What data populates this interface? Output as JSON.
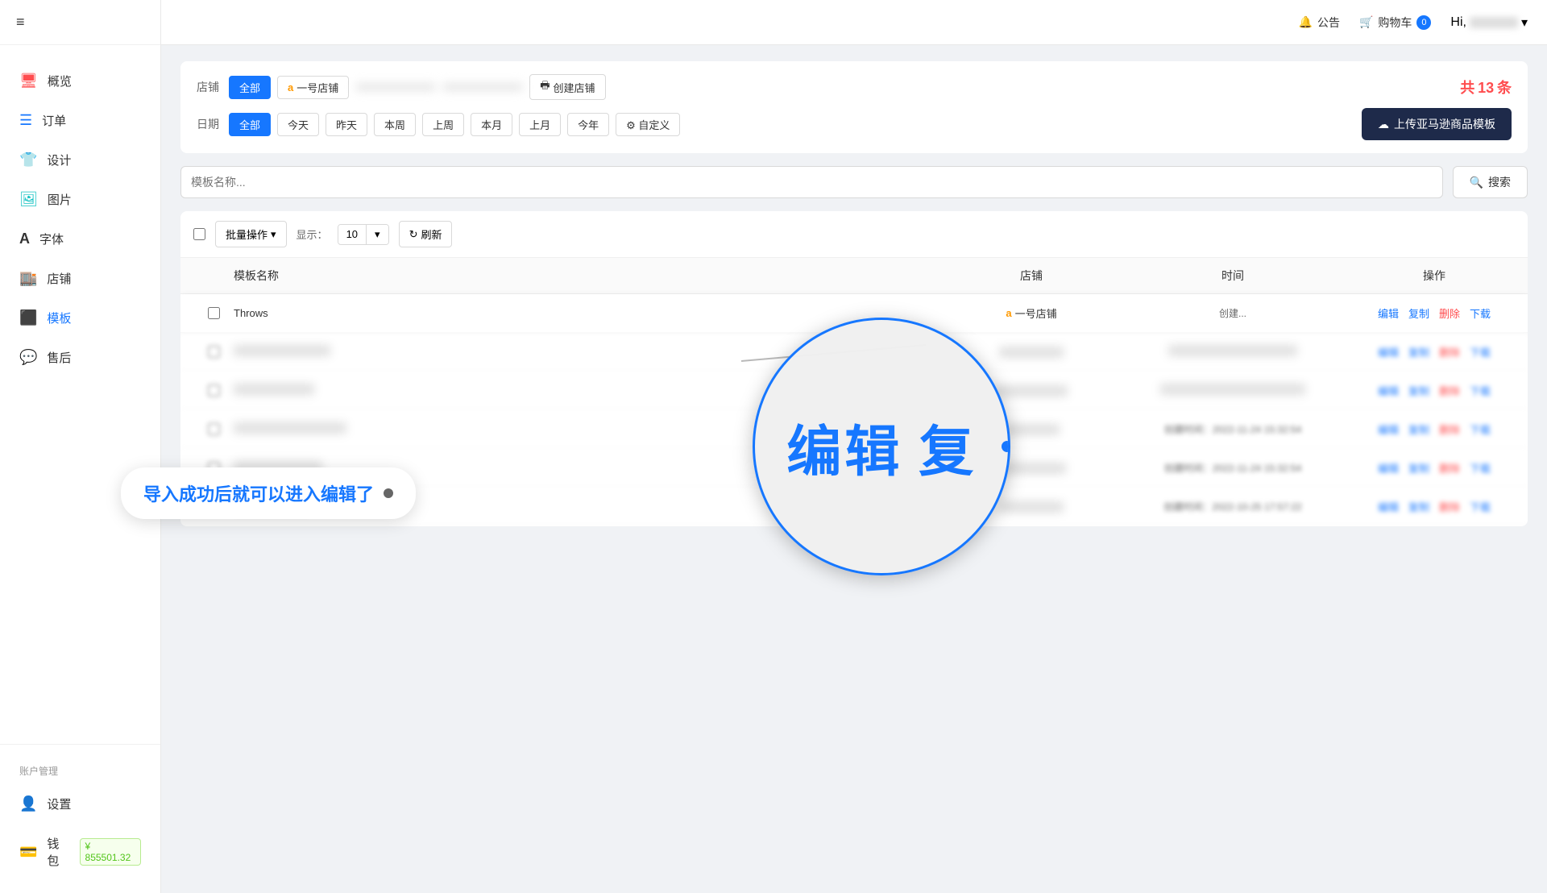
{
  "sidebar": {
    "hamburger": "≡",
    "items": [
      {
        "id": "overview",
        "label": "概览",
        "icon": "📊",
        "class": "overview"
      },
      {
        "id": "orders",
        "label": "订单",
        "icon": "≡",
        "class": "orders"
      },
      {
        "id": "design",
        "label": "设计",
        "icon": "👕",
        "class": "design"
      },
      {
        "id": "images",
        "label": "图片",
        "icon": "🖼",
        "class": "images"
      },
      {
        "id": "fonts",
        "label": "字体",
        "icon": "A",
        "class": "fonts"
      },
      {
        "id": "stores",
        "label": "店铺",
        "icon": "🏬",
        "class": "stores"
      },
      {
        "id": "templates",
        "label": "模板",
        "icon": "⬛",
        "class": "templates"
      },
      {
        "id": "aftersale",
        "label": "售后",
        "icon": "💬",
        "class": "aftersale"
      }
    ],
    "account_label": "账户管理",
    "footer_items": [
      {
        "id": "settings",
        "label": "设置",
        "icon": "👤",
        "class": "settings"
      },
      {
        "id": "wallet",
        "label": "钱包",
        "icon": "💳",
        "class": "wallet",
        "balance": "¥ 855501.32"
      }
    ]
  },
  "topbar": {
    "announcement": "公告",
    "cart": "购物车",
    "cart_count": "0",
    "hi_text": "Hi,"
  },
  "filters": {
    "store_label": "店铺",
    "all_label": "全部",
    "store1": "一号店铺",
    "create_store": "创建店铺",
    "date_label": "日期",
    "date_options": [
      "全部",
      "今天",
      "昨天",
      "本周",
      "上周",
      "本月",
      "上月",
      "今年"
    ],
    "custom_label": "自定义",
    "total_count": "13",
    "total_prefix": "共",
    "total_suffix": "条",
    "upload_btn": "上传亚马逊商品模板"
  },
  "search": {
    "placeholder": "模板名称...",
    "btn_label": "搜索"
  },
  "toolbar": {
    "batch_label": "批量操作",
    "display_label": "显示：",
    "display_count": "10",
    "refresh_label": "刷新"
  },
  "table": {
    "headers": [
      "",
      "模板名称",
      "店铺",
      "时间",
      "操作"
    ],
    "rows": [
      {
        "id": 1,
        "name": "Throws",
        "store": "一号店铺",
        "time": "创建...",
        "highlighted": true,
        "actions": [
          "编辑",
          "复制",
          "删除",
          "下载"
        ]
      },
      {
        "id": 2,
        "name": "",
        "store": "",
        "time": "",
        "blurred": true,
        "actions": [
          "编辑",
          "复制",
          "删除",
          "下载"
        ]
      },
      {
        "id": 3,
        "name": "",
        "store": "",
        "time": "",
        "blurred": true,
        "actions": [
          "编辑",
          "复制",
          "删除",
          "下载"
        ]
      },
      {
        "id": 4,
        "name": "",
        "store": "",
        "time": "创建时间：2022-11-24 15:32:54",
        "blurred": true,
        "actions": [
          "编辑",
          "复制",
          "删除",
          "下载"
        ]
      },
      {
        "id": 5,
        "name": "",
        "store": "",
        "time": "创建时间：2022-11-24 15:32:54",
        "blurred": true,
        "actions": [
          "编辑",
          "复制",
          "删除",
          "下载"
        ]
      },
      {
        "id": 6,
        "name": "",
        "store": "",
        "time": "创建时间：2022-10-25 17:57:22",
        "blurred": true,
        "actions": [
          "编辑",
          "复制",
          "删除",
          "下载"
        ]
      }
    ]
  },
  "zoom": {
    "text1": "编辑",
    "text2": "复"
  },
  "tooltip": {
    "text": "导入成功后就可以进入编辑了"
  }
}
